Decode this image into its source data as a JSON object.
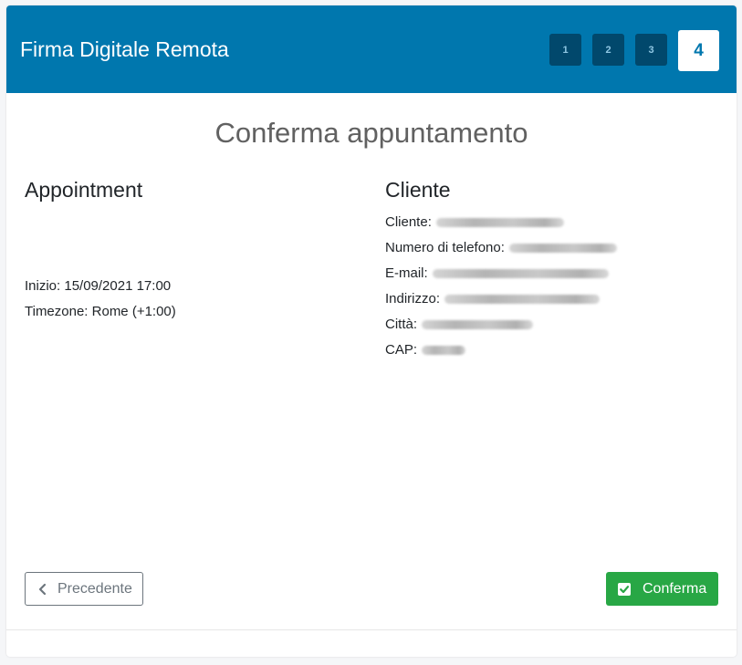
{
  "header": {
    "title": "Firma Digitale Remota",
    "steps": [
      "1",
      "2",
      "3",
      "4"
    ],
    "active_step": "4"
  },
  "page": {
    "title": "Conferma appuntamento"
  },
  "appointment": {
    "heading": "Appointment",
    "start_label": "Inizio: 15/09/2021 17:00",
    "timezone_label": "Timezone: Rome (+1:00)"
  },
  "client": {
    "heading": "Cliente",
    "fields": [
      {
        "label": "Cliente:"
      },
      {
        "label": "Numero di telefono:"
      },
      {
        "label": "E-mail:"
      },
      {
        "label": "Indirizzo:"
      },
      {
        "label": "Città:"
      },
      {
        "label": "CAP:"
      }
    ]
  },
  "actions": {
    "prev_label": "Precedente",
    "confirm_label": "Conferma"
  },
  "colors": {
    "header_bg": "#0077ae",
    "step_inactive_bg": "#01486c",
    "confirm_bg": "#28a745"
  }
}
